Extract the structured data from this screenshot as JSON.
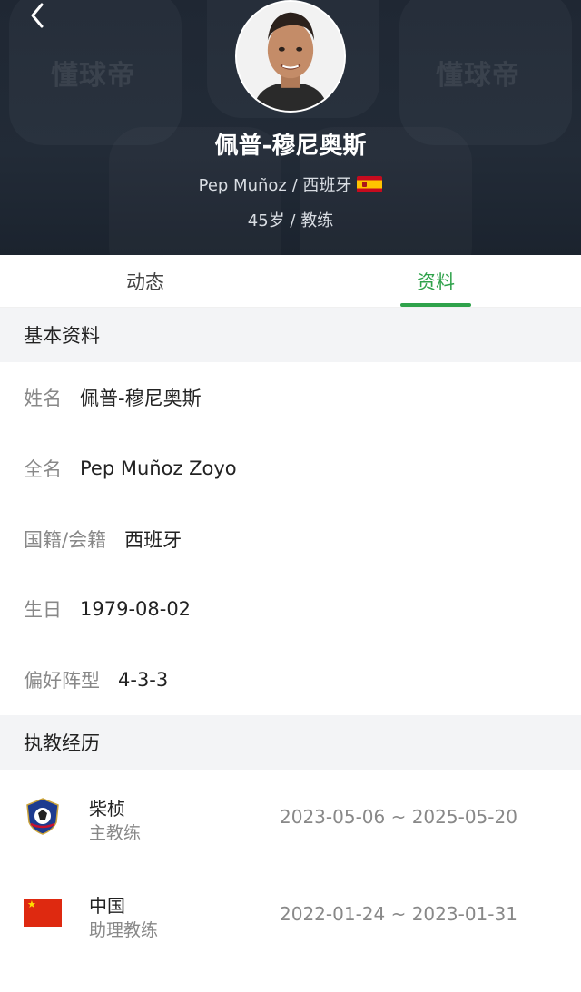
{
  "header": {
    "watermark": "懂球帝",
    "name": "佩普-穆尼奥斯",
    "latin_name_country": "Pep Muñoz / 西班牙",
    "age_role": "45岁 / 教练",
    "flag_icon": "spain-flag-icon"
  },
  "tabs": [
    {
      "label": "动态",
      "active": false
    },
    {
      "label": "资料",
      "active": true
    }
  ],
  "accent_color": "#2fa24b",
  "basic_info": {
    "title": "基本资料",
    "rows": [
      {
        "label": "姓名",
        "value": "佩普-穆尼奥斯"
      },
      {
        "label": "全名",
        "value": "Pep Muñoz Zoyo"
      },
      {
        "label": "国籍/会籍",
        "value": "西班牙"
      },
      {
        "label": "生日",
        "value": "1979-08-02"
      },
      {
        "label": "偏好阵型",
        "value": "4-3-3"
      }
    ]
  },
  "coaching_history": {
    "title": "执教经历",
    "items": [
      {
        "team": "柴桢",
        "role": "主教练",
        "dates": "2023-05-06 ~ 2025-05-20",
        "logo_icon": "club-crest-icon"
      },
      {
        "team": "中国",
        "role": "助理教练",
        "dates": "2022-01-24 ~ 2023-01-31",
        "logo_icon": "china-flag-icon"
      }
    ]
  }
}
